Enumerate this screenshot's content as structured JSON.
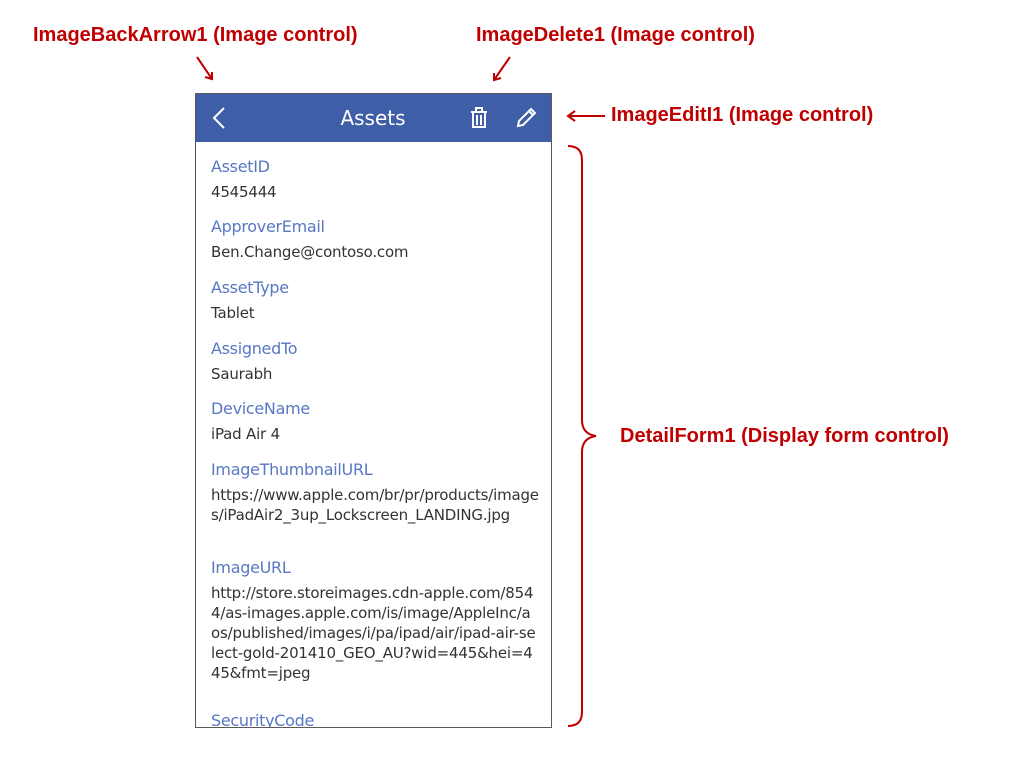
{
  "callouts": {
    "back_arrow": "ImageBackArrow1 (Image control)",
    "delete": "ImageDelete1 (Image control)",
    "edit": "ImageEditI1 (Image control)",
    "form": "DetailForm1 (Display form control)"
  },
  "header": {
    "title": "Assets",
    "icons": [
      "chevron-left-icon",
      "trash-icon",
      "pencil-icon"
    ]
  },
  "fields": [
    {
      "label": "AssetID",
      "value": "4545444"
    },
    {
      "label": "ApproverEmail",
      "value": "Ben.Change@contoso.com"
    },
    {
      "label": "AssetType",
      "value": "Tablet"
    },
    {
      "label": "AssignedTo",
      "value": "Saurabh"
    },
    {
      "label": "DeviceName",
      "value": "iPad Air 4"
    },
    {
      "label": "ImageThumbnailURL",
      "value": "https://www.apple.com/br/pr/products/images/iPadAir2_3up_Lockscreen_LANDING.jpg"
    },
    {
      "label": "ImageURL",
      "value": "http://store.storeimages.cdn-apple.com/8544/as-images.apple.com/is/image/AppleInc/aos/published/images/i/pa/ipad/air/ipad-air-select-gold-201410_GEO_AU?wid=445&hei=445&fmt=jpeg"
    },
    {
      "label": "SecurityCode",
      "value": ""
    }
  ],
  "colors": {
    "header_bg": "#3e5ea8",
    "label": "#5877c4",
    "callout": "#c00000"
  }
}
